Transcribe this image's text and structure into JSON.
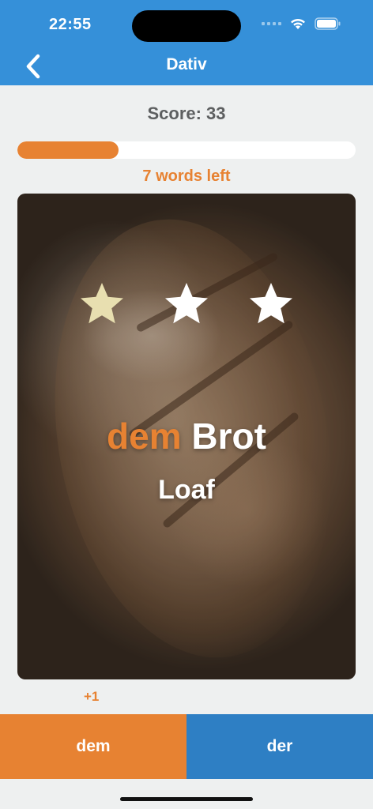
{
  "status_bar": {
    "time": "22:55",
    "icons": [
      "signal-dots-icon",
      "wifi-icon",
      "battery-icon"
    ]
  },
  "nav": {
    "back_icon": "chevron-left-icon",
    "title": "Dativ"
  },
  "quiz": {
    "score_text": "Score: 33",
    "progress_fraction": 0.3,
    "words_left": "7 words left"
  },
  "card": {
    "image": "bread loaf photo",
    "stars": [
      {
        "icon": "star-icon",
        "state": "filled",
        "color": "#e8dfb0"
      },
      {
        "icon": "star-icon",
        "state": "empty",
        "color": "#ffffff"
      },
      {
        "icon": "star-icon",
        "state": "empty",
        "color": "#ffffff"
      }
    ],
    "article": "dem",
    "noun": "Brot",
    "translation": "Loaf"
  },
  "feedback": {
    "points": "+1"
  },
  "answers": {
    "left_label": "dem",
    "right_label": "der"
  },
  "colors": {
    "primary_blue": "#3590d9",
    "accent_orange": "#e78232",
    "button_blue": "#2e7fc4",
    "background": "#eef0f0"
  }
}
